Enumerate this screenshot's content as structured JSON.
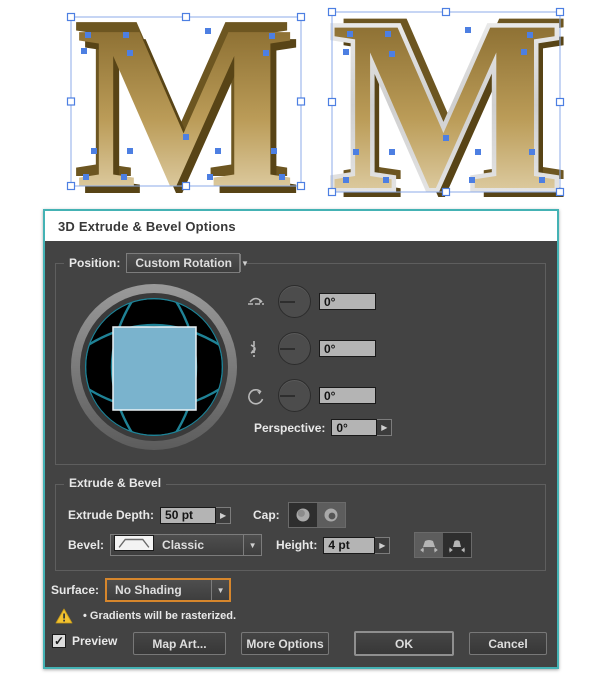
{
  "artboard": {
    "letter": "M"
  },
  "dialog": {
    "title": "3D Extrude & Bevel Options",
    "position": {
      "label": "Position:",
      "value": "Custom Rotation"
    },
    "rotation": {
      "x_value": "0°",
      "y_value": "0°",
      "z_value": "0°",
      "perspective_label": "Perspective:",
      "perspective_value": "0°"
    },
    "extrude": {
      "legend": "Extrude & Bevel",
      "depth_label": "Extrude Depth:",
      "depth_value": "50 pt",
      "cap_label": "Cap:",
      "bevel_label": "Bevel:",
      "bevel_value": "Classic",
      "height_label": "Height:",
      "height_value": "4 pt"
    },
    "surface": {
      "label": "Surface:",
      "value": "No Shading"
    },
    "warning_text": "• Gradients will be rasterized.",
    "footer": {
      "preview_label": "Preview",
      "map_art": "Map Art...",
      "more_options": "More Options",
      "ok": "OK",
      "cancel": "Cancel"
    },
    "colors": {
      "accent_teal": "#44b2b4",
      "highlight_orange": "#d6862c",
      "warning_yellow": "#f2c230",
      "selection_blue": "#4d7fe2"
    }
  }
}
